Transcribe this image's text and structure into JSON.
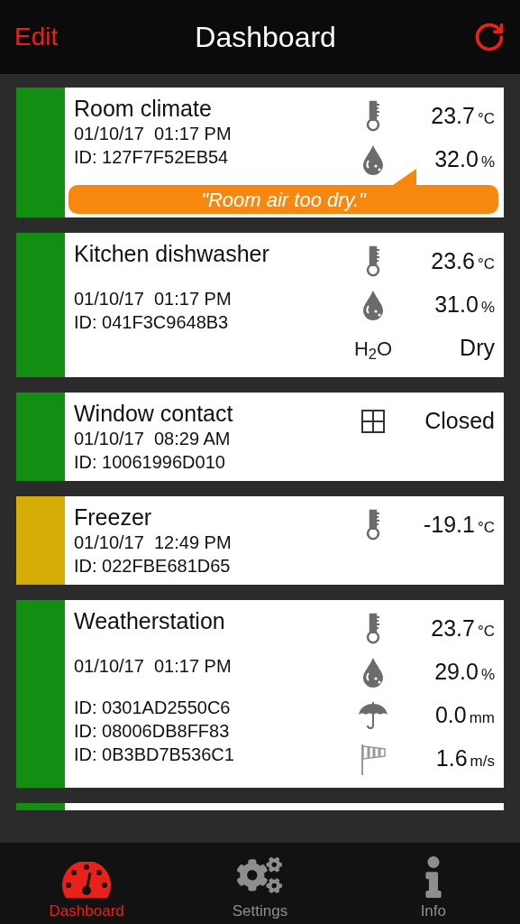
{
  "header": {
    "left_action": "Edit",
    "title": "Dashboard"
  },
  "devices": [
    {
      "name": "Room climate",
      "color": "#138d12",
      "date": "01/10/17  01:17 PM",
      "ids": [
        "ID: 127F7F52EB54"
      ],
      "readings": [
        {
          "kind": "temperature",
          "value": "23.7",
          "unit": "°C"
        },
        {
          "kind": "humidity",
          "value": "32.0",
          "unit": "%"
        }
      ],
      "alert": "\"Room air too dry.\""
    },
    {
      "name": "Kitchen dishwasher",
      "color": "#138d12",
      "date": "01/10/17  01:17 PM",
      "ids": [
        "ID: 041F3C9648B3"
      ],
      "readings": [
        {
          "kind": "temperature",
          "value": "23.6",
          "unit": "°C"
        },
        {
          "kind": "humidity",
          "value": "31.0",
          "unit": "%"
        },
        {
          "kind": "water",
          "label": "H$_{2}$O",
          "value": "Dry"
        }
      ]
    },
    {
      "name": "Window contact",
      "color": "#138d12",
      "date": "01/10/17  08:29 AM",
      "ids": [
        "ID: 10061996D010"
      ],
      "readings": [
        {
          "kind": "contact",
          "value": "Closed"
        }
      ]
    },
    {
      "name": "Freezer",
      "color": "#d6ad06",
      "date": "01/10/17  12:49 PM",
      "ids": [
        "ID: 022FBE681D65"
      ],
      "readings": [
        {
          "kind": "temperature",
          "value": "-19.1",
          "unit": "°C"
        }
      ]
    },
    {
      "name": "Weatherstation",
      "color": "#138d12",
      "date": "01/10/17  01:17 PM",
      "ids": [
        "ID: 0301AD2550C6",
        "ID: 08006DB8FF83",
        "ID: 0B3BD7B536C1"
      ],
      "readings": [
        {
          "kind": "temperature",
          "value": "23.7",
          "unit": "°C"
        },
        {
          "kind": "humidity",
          "value": "29.0",
          "unit": "%"
        },
        {
          "kind": "rain",
          "value": "0.0",
          "unit": "mm"
        },
        {
          "kind": "wind",
          "value": "1.6",
          "unit": "m/s"
        }
      ]
    }
  ],
  "partial_card": {
    "color": "#138d12"
  },
  "tabs": [
    {
      "label": "Dashboard",
      "kind": "gauge",
      "selected": true
    },
    {
      "label": "Settings",
      "kind": "gears",
      "selected": false
    },
    {
      "label": "Info",
      "kind": "info",
      "selected": false
    }
  ]
}
